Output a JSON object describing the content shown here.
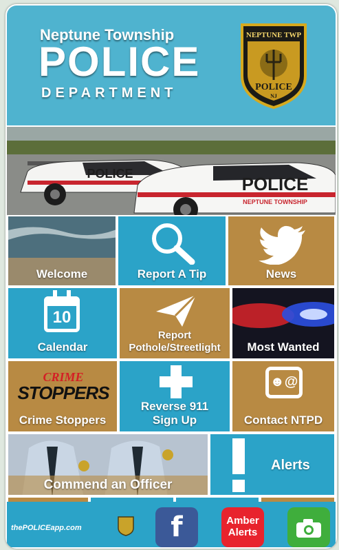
{
  "header": {
    "line1": "Neptune Township",
    "line2": "POLICE",
    "line3": "DEPARTMENT"
  },
  "badge": {
    "top_text": "NEPTUNE TWP",
    "mid_text": "POLICE",
    "bottom_text": "NJ"
  },
  "banner": {
    "car_text_1": "POLICE",
    "car_text_2": "POLICE",
    "car_sub": "NEPTUNE TOWNSHIP"
  },
  "tiles": {
    "welcome": "Welcome",
    "report_tip": "Report A Tip",
    "news": "News",
    "calendar": "Calendar",
    "calendar_day": "10",
    "report_pothole": "Report Pothole/Streetlight",
    "most_wanted": "Most Wanted",
    "crime_stoppers_logo_1": "CRIME",
    "crime_stoppers_logo_2": "STOPPERS",
    "crime_stoppers": "Crime Stoppers",
    "reverse_911": "Reverse 911 Sign Up",
    "contact": "Contact NTPD",
    "commend": "Commend an Officer",
    "alerts": "Alerts"
  },
  "bottombar": {
    "app_link": "thePOLICEapp.com",
    "facebook": "f",
    "amber": "Amber Alerts"
  },
  "colors": {
    "header_blue": "#4fb3cf",
    "tile_blue": "#2ba3c8",
    "tile_tan": "#b88a43",
    "amber_red": "#e8232d",
    "camera_green": "#3fae3c",
    "facebook_blue": "#3b5998"
  }
}
